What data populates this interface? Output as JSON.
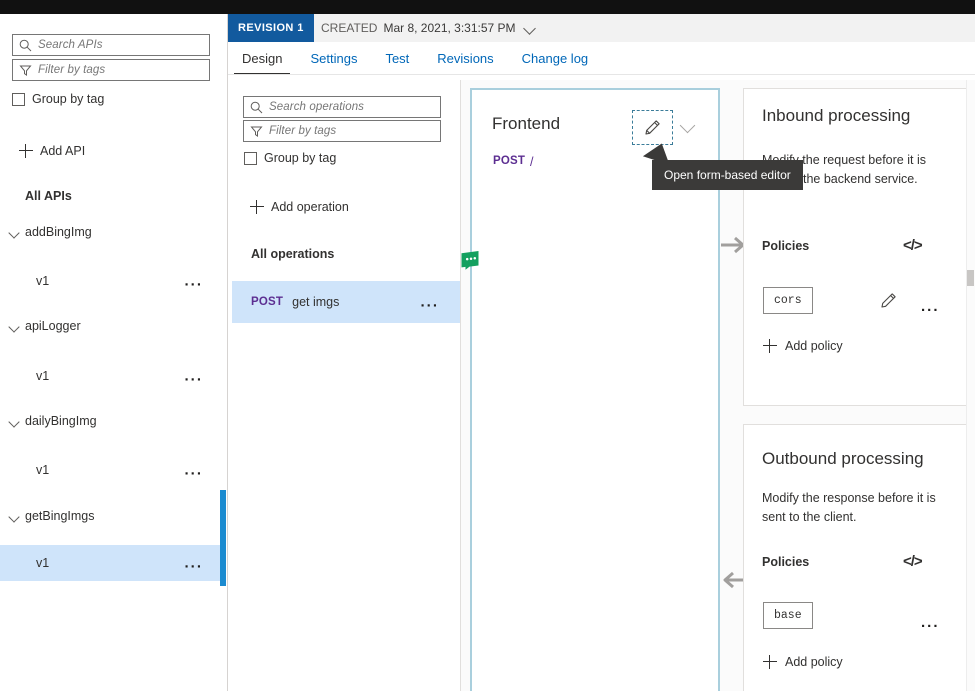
{
  "theme": {
    "accent": "#0078d4",
    "revision_badge_bg": "#125a9e",
    "selected_row_bg": "#cfe4fa",
    "method_color": "#5c2e91",
    "panel_highlight_border": "#a9cfdd",
    "tooltip_bg": "#3b3a39",
    "feedback_green": "#13a05f"
  },
  "sidebar": {
    "search": {
      "placeholder": "Search APIs",
      "value": "",
      "icon": "search-icon"
    },
    "filter": {
      "placeholder": "Filter by tags",
      "value": "",
      "icon": "filter-icon"
    },
    "group_by_tag_label": "Group by tag",
    "group_by_tag_checked": false,
    "add_api_label": "Add API",
    "all_apis_label": "All APIs",
    "more_label": "...",
    "apis": [
      {
        "name": "addBingImg",
        "expanded": true,
        "versions": [
          {
            "label": "v1",
            "selected": false
          }
        ]
      },
      {
        "name": "apiLogger",
        "expanded": true,
        "versions": [
          {
            "label": "v1",
            "selected": false
          }
        ]
      },
      {
        "name": "dailyBingImg",
        "expanded": true,
        "versions": [
          {
            "label": "v1",
            "selected": false
          }
        ]
      },
      {
        "name": "getBingImgs",
        "expanded": true,
        "versions": [
          {
            "label": "v1",
            "selected": true
          }
        ]
      }
    ]
  },
  "revision": {
    "badge": "REVISION 1",
    "created_label": "CREATED",
    "created_value": "Mar 8, 2021, 3:31:57 PM"
  },
  "tabs": [
    {
      "label": "Design",
      "active": true
    },
    {
      "label": "Settings",
      "active": false
    },
    {
      "label": "Test",
      "active": false
    },
    {
      "label": "Revisions",
      "active": false
    },
    {
      "label": "Change log",
      "active": false
    }
  ],
  "operations": {
    "search": {
      "placeholder": "Search operations",
      "value": ""
    },
    "filter": {
      "placeholder": "Filter by tags",
      "value": ""
    },
    "group_by_tag_label": "Group by tag",
    "group_by_tag_checked": false,
    "add_operation_label": "Add operation",
    "all_operations_label": "All operations",
    "more_label": "...",
    "items": [
      {
        "method": "POST",
        "name": "get imgs",
        "selected": true
      }
    ]
  },
  "frontend": {
    "title": "Frontend",
    "method": "POST",
    "path": "/",
    "edit_icon": "pencil-icon",
    "expand_icon": "chevron-down-icon"
  },
  "tooltip": {
    "text": "Open form-based editor"
  },
  "inbound": {
    "title": "Inbound processing",
    "description": "Modify the request before it is sent to the backend service.",
    "policies_label": "Policies",
    "code_icon": "code-editor-icon",
    "policies": [
      {
        "label": "cors"
      }
    ],
    "edit_icon": "pencil-icon",
    "more_label": "...",
    "add_policy_label": "Add policy"
  },
  "outbound": {
    "title": "Outbound processing",
    "description": "Modify the response before it is sent to the client.",
    "policies_label": "Policies",
    "code_icon": "code-editor-icon",
    "policies": [
      {
        "label": "base"
      }
    ],
    "more_label": "...",
    "add_policy_label": "Add policy"
  }
}
